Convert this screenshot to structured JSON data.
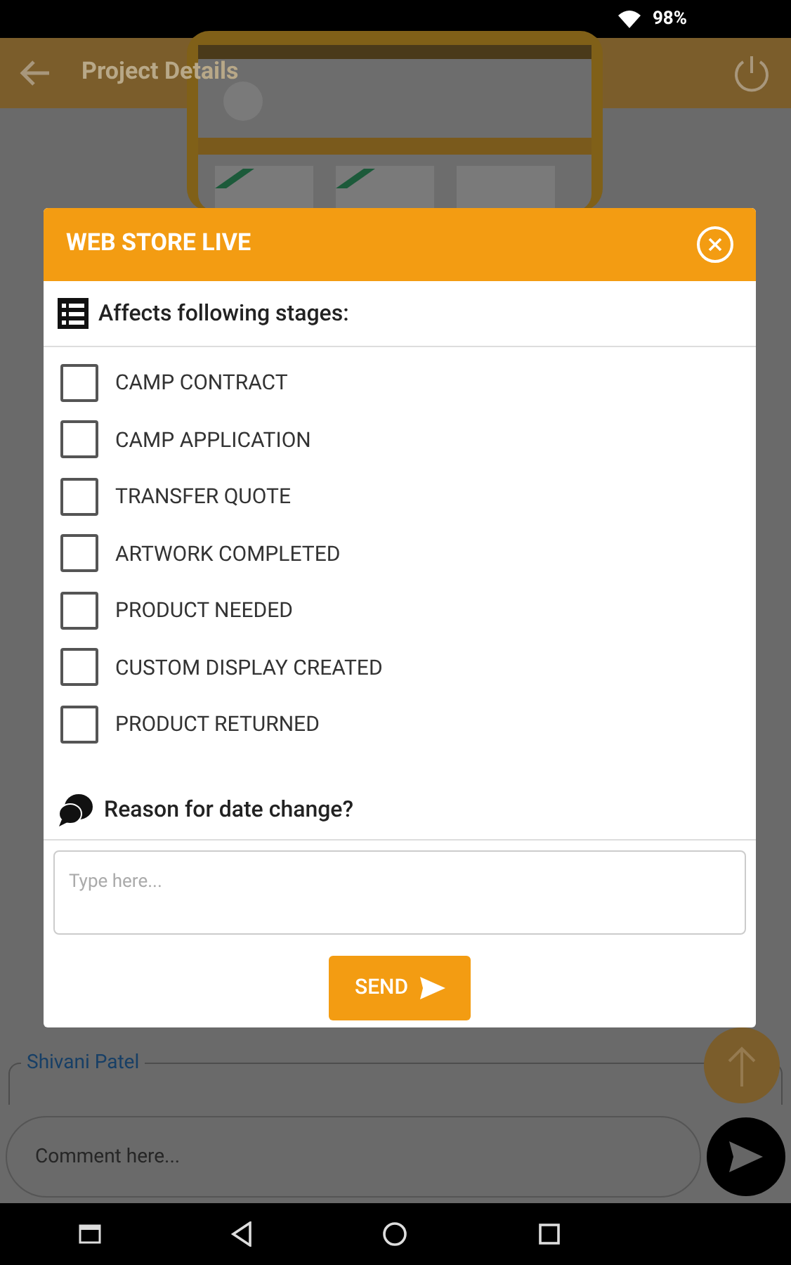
{
  "status_bar": {
    "battery": "98%"
  },
  "app_bar": {
    "title": "Project Details"
  },
  "background": {
    "comment_author": "Shivani Patel",
    "comment_field": {
      "placeholder": "Comment here..."
    }
  },
  "dialog": {
    "title": "WEB STORE LIVE",
    "stages_heading": "Affects following stages:",
    "stages": [
      {
        "label": "CAMP CONTRACT",
        "checked": false
      },
      {
        "label": "CAMP APPLICATION",
        "checked": false
      },
      {
        "label": "TRANSFER QUOTE",
        "checked": false
      },
      {
        "label": "ARTWORK COMPLETED",
        "checked": false
      },
      {
        "label": "PRODUCT NEEDED",
        "checked": false
      },
      {
        "label": "CUSTOM DISPLAY CREATED",
        "checked": false
      },
      {
        "label": "PRODUCT RETURNED",
        "checked": false
      }
    ],
    "reason_heading": "Reason for date change?",
    "reason_field": {
      "placeholder": "Type here..."
    },
    "send_button": "SEND"
  }
}
